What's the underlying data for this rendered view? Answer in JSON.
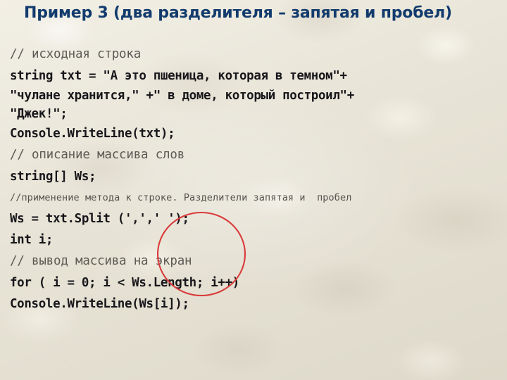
{
  "slide": {
    "title": "Пример 3 (два разделителя – запятая и пробел)",
    "background_color": "#e9e5d9",
    "title_color": "#123b6d",
    "code_color": "#17161a",
    "comment_color": "#5d5a55",
    "annotation_color": "#d93a3a"
  },
  "code": {
    "lines": [
      {
        "text": "// исходная строка",
        "kind": "comment"
      },
      {
        "text": "string txt = \"А это пшеница, которая в темном\"+",
        "kind": "code"
      },
      {
        "text": "\"чулане хранится,\" +\" в доме, который построил\"+",
        "kind": "code-cont"
      },
      {
        "text": "\"Джек!\";",
        "kind": "code-cont"
      },
      {
        "text": "Console.WriteLine(txt);",
        "kind": "code"
      },
      {
        "text": "// описание массива слов",
        "kind": "comment"
      },
      {
        "text": "string[] Ws;",
        "kind": "code"
      },
      {
        "text": "//применение метода к строке. Разделители запятая и  пробел",
        "kind": "comment-small"
      },
      {
        "text": "Ws = txt.Split (',',' ');",
        "kind": "code"
      },
      {
        "text": "int i;",
        "kind": "code"
      },
      {
        "text": "// вывод массива на экран",
        "kind": "comment"
      },
      {
        "text": "for ( i = 0; i < Ws.Length; i++)",
        "kind": "code"
      },
      {
        "text": "Console.WriteLine(Ws[i]);",
        "kind": "code"
      }
    ]
  },
  "annotation": {
    "shape": "ellipse",
    "label": "red-ellipse-highlight",
    "target": "Ws = txt.Split (',',' ');"
  }
}
